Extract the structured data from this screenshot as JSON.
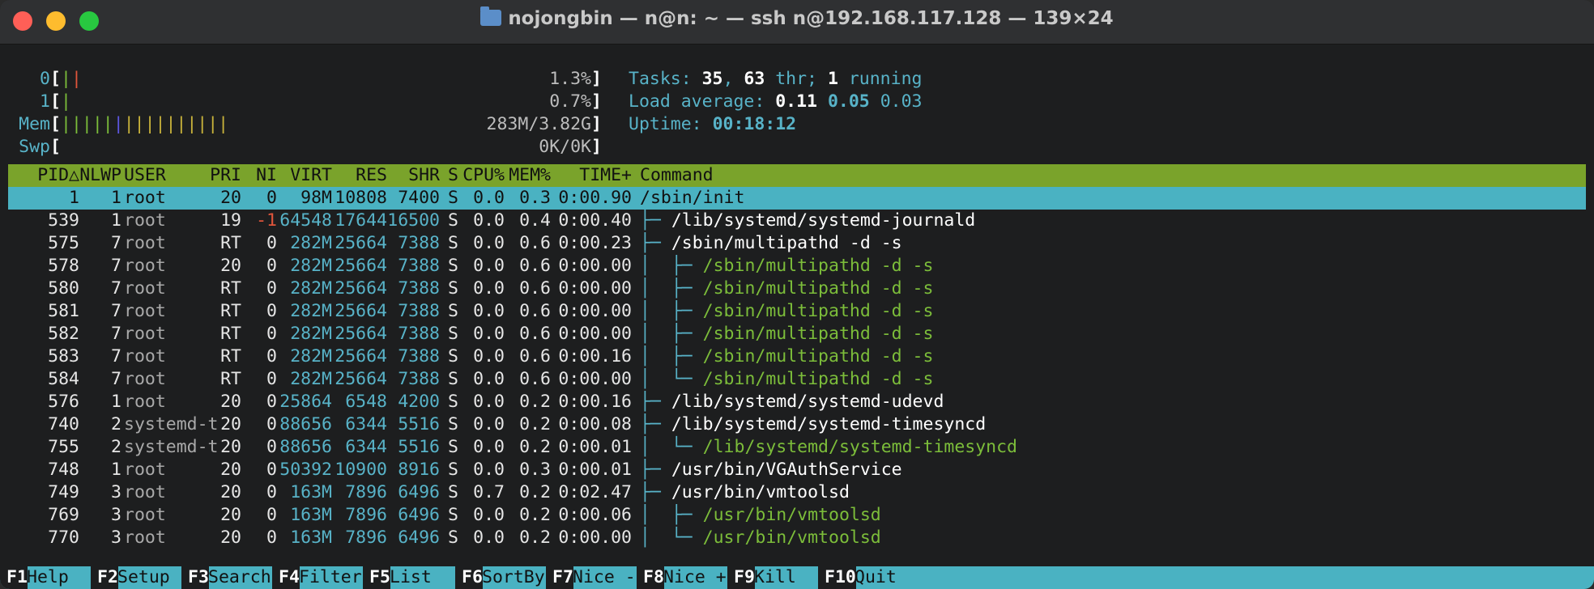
{
  "window": {
    "title": "nojongbin — n@n: ~ — ssh n@192.168.117.128 — 139×24",
    "icon": "folder-icon"
  },
  "meters": {
    "cpu0": {
      "label": "0",
      "value": "1.3%"
    },
    "cpu1": {
      "label": "1",
      "value": "0.7%"
    },
    "mem": {
      "label": "Mem",
      "value": "283M/3.82G"
    },
    "swp": {
      "label": "Swp",
      "value": "0K/0K"
    }
  },
  "stats": {
    "tasks_label": "Tasks: ",
    "tasks": "35",
    "sep1": ", ",
    "threads": "63",
    "thr_label": " thr; ",
    "running": "1",
    "running_label": " running",
    "load_label": "Load average: ",
    "load1": "0.11",
    "load5": "0.05",
    "load15": "0.03",
    "uptime_label": "Uptime: ",
    "uptime": "00:18:12"
  },
  "columns": [
    "PID△",
    "NLWP",
    "USER",
    "PRI",
    "NI",
    "VIRT",
    "RES",
    "SHR",
    "S",
    "CPU%",
    "MEM%",
    "TIME+",
    "Command"
  ],
  "processes": [
    {
      "pid": "1",
      "nlwp": "1",
      "user": "root",
      "pri": "20",
      "ni": "0",
      "virt": "98M",
      "res": "10808",
      "shr": "7400",
      "s": "S",
      "cpu": "0.0",
      "mem": "0.3",
      "time": "0:00.90",
      "tree": "",
      "cmd": "/sbin/init"
    },
    {
      "pid": "539",
      "nlwp": "1",
      "user": "root",
      "pri": "19",
      "ni": "-1",
      "virt": "64548",
      "res": "17644",
      "shr": "16500",
      "s": "S",
      "cpu": "0.0",
      "mem": "0.4",
      "time": "0:00.40",
      "tree": "├─ ",
      "cmd": "/lib/systemd/systemd-journald"
    },
    {
      "pid": "575",
      "nlwp": "7",
      "user": "root",
      "pri": "RT",
      "ni": "0",
      "virt": "282M",
      "res": "25664",
      "shr": "7388",
      "s": "S",
      "cpu": "0.0",
      "mem": "0.6",
      "time": "0:00.23",
      "tree": "├─ ",
      "cmd": "/sbin/multipathd -d -s"
    },
    {
      "pid": "578",
      "nlwp": "7",
      "user": "root",
      "pri": "20",
      "ni": "0",
      "virt": "282M",
      "res": "25664",
      "shr": "7388",
      "s": "S",
      "cpu": "0.0",
      "mem": "0.6",
      "time": "0:00.00",
      "tree": "│  ├─ ",
      "cmd": "/sbin/multipathd -d -s"
    },
    {
      "pid": "580",
      "nlwp": "7",
      "user": "root",
      "pri": "RT",
      "ni": "0",
      "virt": "282M",
      "res": "25664",
      "shr": "7388",
      "s": "S",
      "cpu": "0.0",
      "mem": "0.6",
      "time": "0:00.00",
      "tree": "│  ├─ ",
      "cmd": "/sbin/multipathd -d -s"
    },
    {
      "pid": "581",
      "nlwp": "7",
      "user": "root",
      "pri": "RT",
      "ni": "0",
      "virt": "282M",
      "res": "25664",
      "shr": "7388",
      "s": "S",
      "cpu": "0.0",
      "mem": "0.6",
      "time": "0:00.00",
      "tree": "│  ├─ ",
      "cmd": "/sbin/multipathd -d -s"
    },
    {
      "pid": "582",
      "nlwp": "7",
      "user": "root",
      "pri": "RT",
      "ni": "0",
      "virt": "282M",
      "res": "25664",
      "shr": "7388",
      "s": "S",
      "cpu": "0.0",
      "mem": "0.6",
      "time": "0:00.00",
      "tree": "│  ├─ ",
      "cmd": "/sbin/multipathd -d -s"
    },
    {
      "pid": "583",
      "nlwp": "7",
      "user": "root",
      "pri": "RT",
      "ni": "0",
      "virt": "282M",
      "res": "25664",
      "shr": "7388",
      "s": "S",
      "cpu": "0.0",
      "mem": "0.6",
      "time": "0:00.16",
      "tree": "│  ├─ ",
      "cmd": "/sbin/multipathd -d -s"
    },
    {
      "pid": "584",
      "nlwp": "7",
      "user": "root",
      "pri": "RT",
      "ni": "0",
      "virt": "282M",
      "res": "25664",
      "shr": "7388",
      "s": "S",
      "cpu": "0.0",
      "mem": "0.6",
      "time": "0:00.00",
      "tree": "│  └─ ",
      "cmd": "/sbin/multipathd -d -s"
    },
    {
      "pid": "576",
      "nlwp": "1",
      "user": "root",
      "pri": "20",
      "ni": "0",
      "virt": "25864",
      "res": "6548",
      "shr": "4200",
      "s": "S",
      "cpu": "0.0",
      "mem": "0.2",
      "time": "0:00.16",
      "tree": "├─ ",
      "cmd": "/lib/systemd/systemd-udevd"
    },
    {
      "pid": "740",
      "nlwp": "2",
      "user": "systemd-t",
      "pri": "20",
      "ni": "0",
      "virt": "88656",
      "res": "6344",
      "shr": "5516",
      "s": "S",
      "cpu": "0.0",
      "mem": "0.2",
      "time": "0:00.08",
      "tree": "├─ ",
      "cmd": "/lib/systemd/systemd-timesyncd"
    },
    {
      "pid": "755",
      "nlwp": "2",
      "user": "systemd-t",
      "pri": "20",
      "ni": "0",
      "virt": "88656",
      "res": "6344",
      "shr": "5516",
      "s": "S",
      "cpu": "0.0",
      "mem": "0.2",
      "time": "0:00.01",
      "tree": "│  └─ ",
      "cmd": "/lib/systemd/systemd-timesyncd"
    },
    {
      "pid": "748",
      "nlwp": "1",
      "user": "root",
      "pri": "20",
      "ni": "0",
      "virt": "50392",
      "res": "10900",
      "shr": "8916",
      "s": "S",
      "cpu": "0.0",
      "mem": "0.3",
      "time": "0:00.01",
      "tree": "├─ ",
      "cmd": "/usr/bin/VGAuthService"
    },
    {
      "pid": "749",
      "nlwp": "3",
      "user": "root",
      "pri": "20",
      "ni": "0",
      "virt": "163M",
      "res": "7896",
      "shr": "6496",
      "s": "S",
      "cpu": "0.7",
      "mem": "0.2",
      "time": "0:02.47",
      "tree": "├─ ",
      "cmd": "/usr/bin/vmtoolsd"
    },
    {
      "pid": "769",
      "nlwp": "3",
      "user": "root",
      "pri": "20",
      "ni": "0",
      "virt": "163M",
      "res": "7896",
      "shr": "6496",
      "s": "S",
      "cpu": "0.0",
      "mem": "0.2",
      "time": "0:00.06",
      "tree": "│  ├─ ",
      "cmd": "/usr/bin/vmtoolsd"
    },
    {
      "pid": "770",
      "nlwp": "3",
      "user": "root",
      "pri": "20",
      "ni": "0",
      "virt": "163M",
      "res": "7896",
      "shr": "6496",
      "s": "S",
      "cpu": "0.0",
      "mem": "0.2",
      "time": "0:00.00",
      "tree": "│  └─ ",
      "cmd": "/usr/bin/vmtoolsd"
    }
  ],
  "footer": [
    {
      "key": "F1",
      "label": "Help"
    },
    {
      "key": "F2",
      "label": "Setup"
    },
    {
      "key": "F3",
      "label": "Search"
    },
    {
      "key": "F4",
      "label": "Filter"
    },
    {
      "key": "F5",
      "label": "List"
    },
    {
      "key": "F6",
      "label": "SortBy"
    },
    {
      "key": "F7",
      "label": "Nice -"
    },
    {
      "key": "F8",
      "label": "Nice +"
    },
    {
      "key": "F9",
      "label": "Kill"
    },
    {
      "key": "F10",
      "label": "Quit"
    }
  ]
}
